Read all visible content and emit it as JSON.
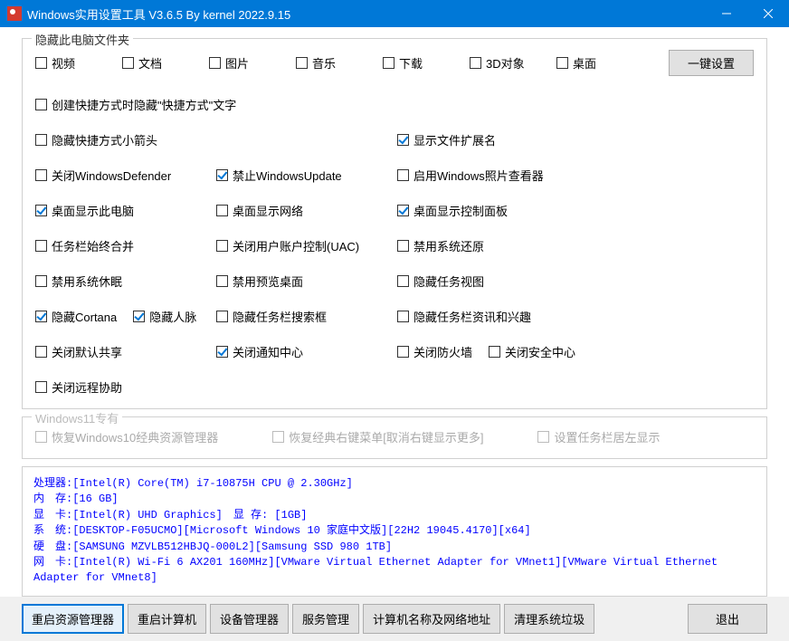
{
  "title": "Windows实用设置工具 V3.6.5 By kernel 2022.9.15",
  "group_hide_folder": {
    "title": "隐藏此电脑文件夹",
    "items": [
      "视频",
      "文档",
      "图片",
      "音乐",
      "下载",
      "3D对象",
      "桌面"
    ],
    "oneclick": "一键设置"
  },
  "opts": {
    "r1c1": "创建快捷方式时隐藏\"快捷方式\"文字",
    "r1c3": "隐藏快捷方式小箭头",
    "r2c1": "显示文件扩展名",
    "r2c2": "关闭WindowsDefender",
    "r2c3": "禁止WindowsUpdate",
    "r2c4": "启用Windows照片查看器",
    "r3c1": "桌面显示此电脑",
    "r3c2": "桌面显示网络",
    "r3c3": "桌面显示控制面板",
    "r3c4": "任务栏始终合并",
    "r4c1": "关闭用户账户控制(UAC)",
    "r4c2": "禁用系统还原",
    "r4c3": "禁用系统休眠",
    "r4c4": "禁用预览桌面",
    "r5c1": "隐藏任务视图",
    "r5c2": "隐藏Cortana",
    "r5c2b": "隐藏人脉",
    "r5c3": "隐藏任务栏搜索框",
    "r5c4": "隐藏任务栏资讯和兴趣",
    "r6c1": "关闭默认共享",
    "r6c2": "关闭通知中心",
    "r6c3": "关闭防火墙",
    "r6c3b": "关闭安全中心",
    "r6c4": "关闭远程协助"
  },
  "win11": {
    "title": "Windows11专有",
    "a": "恢复Windows10经典资源管理器",
    "b": "恢复经典右键菜单[取消右键显示更多]",
    "c": "设置任务栏居左显示"
  },
  "sys": {
    "cpu_k": "处理器: ",
    "cpu_v": "[Intel(R) Core(TM) i7-10875H CPU @ 2.30GHz]",
    "mem_k": "内　存: ",
    "mem_v": "[16 GB]",
    "gpu_k": "显　卡: ",
    "gpu_v": "[Intel(R) UHD Graphics]　显 存: [1GB]",
    "os_k": "系　统: ",
    "os_v": "[DESKTOP-F05UCMO][Microsoft Windows 10 家庭中文版][22H2 19045.4170][x64]",
    "hd_k": "硬　盘: ",
    "hd_v": "[SAMSUNG MZVLB512HBJQ-000L2][Samsung SSD 980 1TB]",
    "net_k": "网　卡: ",
    "net_v": "[Intel(R) Wi-Fi 6 AX201 160MHz][VMware Virtual Ethernet Adapter for VMnet1][VMware Virtual Ethernet Adapter for VMnet8]"
  },
  "btns": {
    "restart_explorer": "重启资源管理器",
    "restart_pc": "重启计算机",
    "devmgr": "设备管理器",
    "services": "服务管理",
    "netname": "计算机名称及网络地址",
    "clean": "清理系统垃圾",
    "exit": "退出"
  }
}
